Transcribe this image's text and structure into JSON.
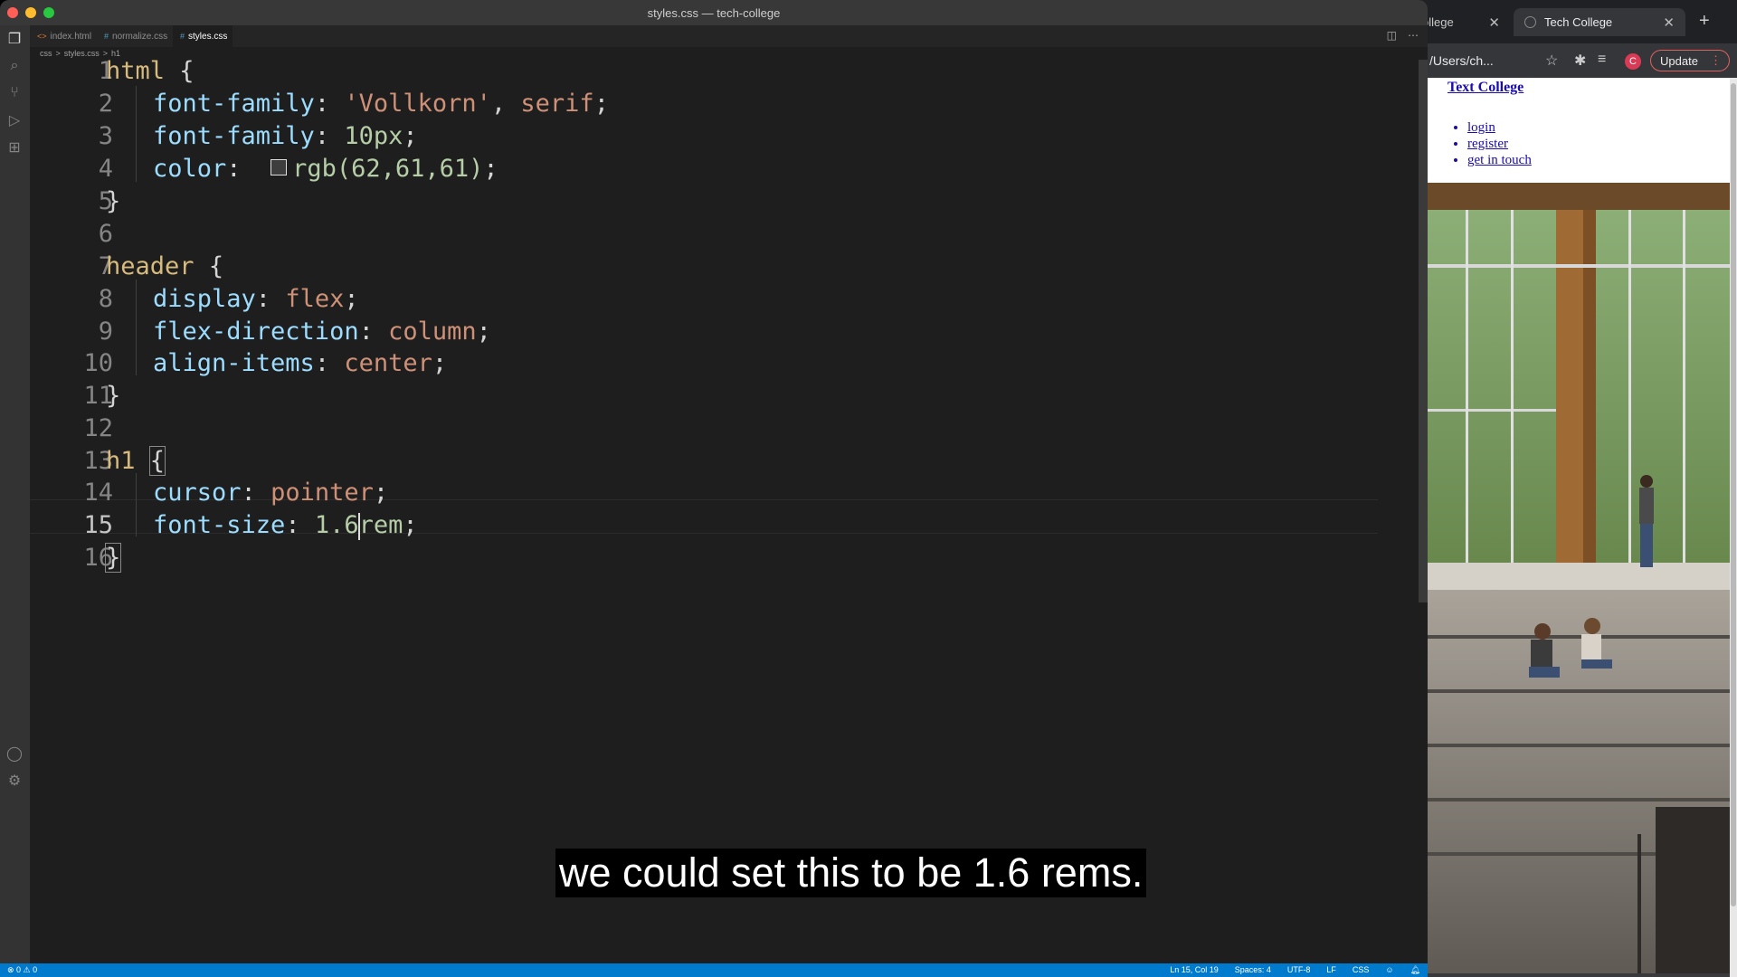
{
  "browser": {
    "tabs": [
      {
        "label": "ollege",
        "close": "✕"
      },
      {
        "label": "Tech College",
        "close": "✕"
      }
    ],
    "new_tab": "+",
    "url": "/Users/ch...",
    "profile_initial": "C",
    "update_label": "Update",
    "page": {
      "title": "Text College",
      "nav": [
        "login",
        "register",
        "get in touch"
      ]
    }
  },
  "vscode": {
    "window_title": "styles.css — tech-college",
    "tabs": [
      {
        "label": "index.html",
        "icon": "<>"
      },
      {
        "label": "normalize.css",
        "icon": "#"
      },
      {
        "label": "styles.css",
        "icon": "#"
      }
    ],
    "breadcrumb": [
      "css",
      ">",
      "styles.css",
      ">",
      "h1"
    ],
    "line_numbers": [
      "1",
      "2",
      "3",
      "4",
      "5",
      "6",
      "7",
      "8",
      "9",
      "10",
      "11",
      "12",
      "13",
      "14",
      "15",
      "16"
    ],
    "code": {
      "l1_sel": "html",
      "l1_brace": "{",
      "l2_prop": "font-family",
      "l2_val": "'Vollkorn'",
      "l2_val2": "serif",
      "l3_prop": "font-family",
      "l3_val": "10px",
      "l4_prop": "color",
      "l4_val": "rgb(62,61,61)",
      "l5": "}",
      "l7_sel": "header",
      "l7_brace": "{",
      "l8_prop": "display",
      "l8_val": "flex",
      "l9_prop": "flex-direction",
      "l9_val": "column",
      "l10_prop": "align-items",
      "l10_val": "center",
      "l11": "}",
      "l13_sel": "h1",
      "l13_brace": "{",
      "l14_prop": "cursor",
      "l14_val": "pointer",
      "l15_prop": "font-size",
      "l15_val_a": "1.6",
      "l15_val_b": "rem",
      "l16": "}"
    },
    "swatch_color": "#3e3d3d",
    "status": {
      "left": "⊗ 0 ⚠ 0",
      "position": "Ln 15, Col 19",
      "spaces": "Spaces: 4",
      "encoding": "UTF-8",
      "eol": "LF",
      "language": "CSS"
    }
  },
  "caption": "we could set this to be 1.6 rems."
}
